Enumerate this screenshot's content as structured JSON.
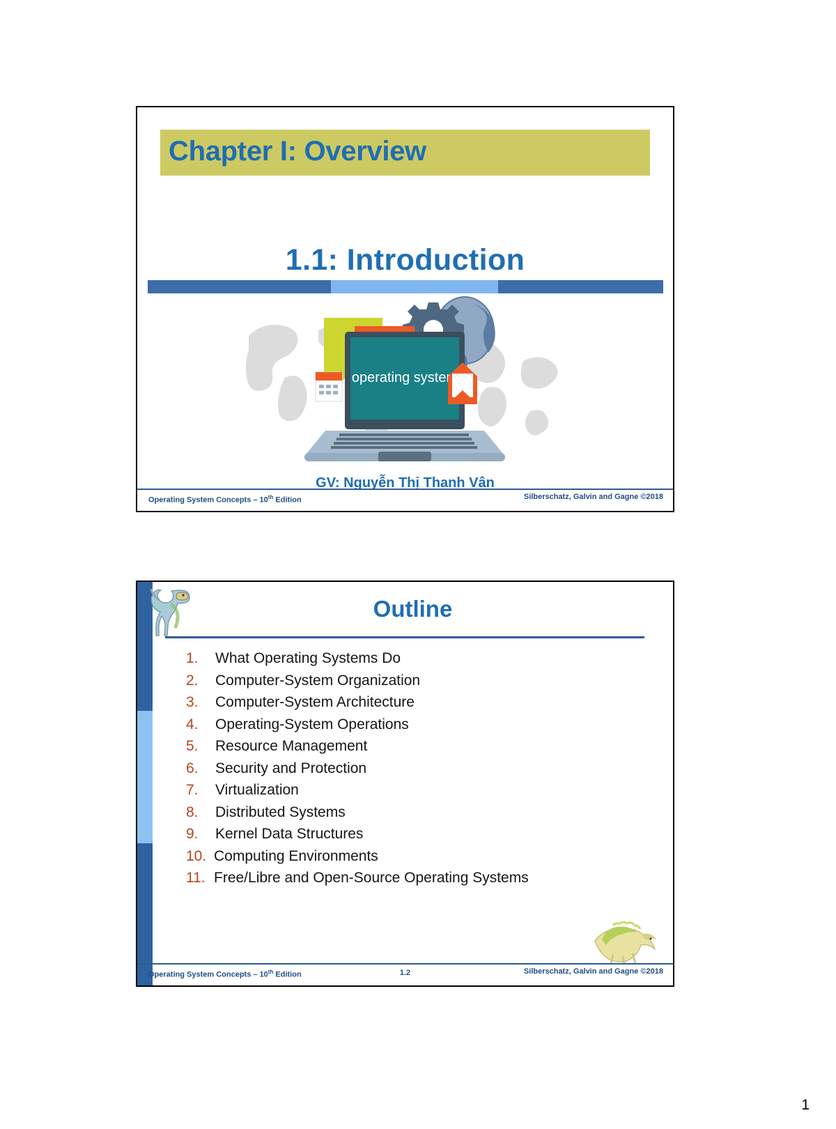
{
  "document": {
    "page_number": "1"
  },
  "slide1": {
    "name": "title-slide",
    "chapter_banner": "Chapter I: Overview",
    "subtitle": "1.1:  Introduction",
    "illustration": {
      "name": "laptop-operating-system-illustration",
      "screen_text": "operating system",
      "elements": [
        "world-map",
        "globe-icon",
        "gear-icon",
        "speech-bubble-green",
        "speech-bubble-orange",
        "calendar-icon",
        "envelope-icon",
        "laptop-icon"
      ]
    },
    "instructor": "GV: Nguyễn Thị Thanh Vân",
    "footer": {
      "left_prefix": "Operating System Concepts – 10",
      "left_sup": "th",
      "left_suffix": " Edition",
      "center": "",
      "right": "Silberschatz, Galvin and Gagne ©2018"
    }
  },
  "slide2": {
    "name": "outline-slide",
    "title": "Outline",
    "dino_top": "dinosaur-icon",
    "dino_bottom": "spinosaurus-icon",
    "items": [
      {
        "num": "1.",
        "label": "What Operating Systems Do"
      },
      {
        "num": "2.",
        "label": "Computer-System Organization"
      },
      {
        "num": "3.",
        "label": "Computer-System Architecture"
      },
      {
        "num": "4.",
        "label": "Operating-System Operations"
      },
      {
        "num": "5.",
        "label": "Resource Management"
      },
      {
        "num": "6.",
        "label": "Security and Protection"
      },
      {
        "num": "7.",
        "label": "Virtualization"
      },
      {
        "num": "8.",
        "label": "Distributed Systems"
      },
      {
        "num": "9.",
        "label": "Kernel Data Structures"
      },
      {
        "num": "10.",
        "label": "Computing Environments"
      },
      {
        "num": "11.",
        "label": "Free/Libre and Open-Source Operating Systems"
      }
    ],
    "footer": {
      "left_prefix": "Operating System Concepts – 10",
      "left_sup": "th",
      "left_suffix": " Edition",
      "center": "1.2",
      "right": "Silberschatz, Galvin and Gagne ©2018"
    }
  },
  "colors": {
    "banner_olive": "#cdca63",
    "title_blue": "#1f6eb4",
    "rule_dark_blue": "#3d6da8",
    "rule_light_blue": "#7fb6ef",
    "footer_blue": "#1f4e82",
    "number_orange": "#b8451f",
    "screen_teal": "#1b7f86"
  }
}
